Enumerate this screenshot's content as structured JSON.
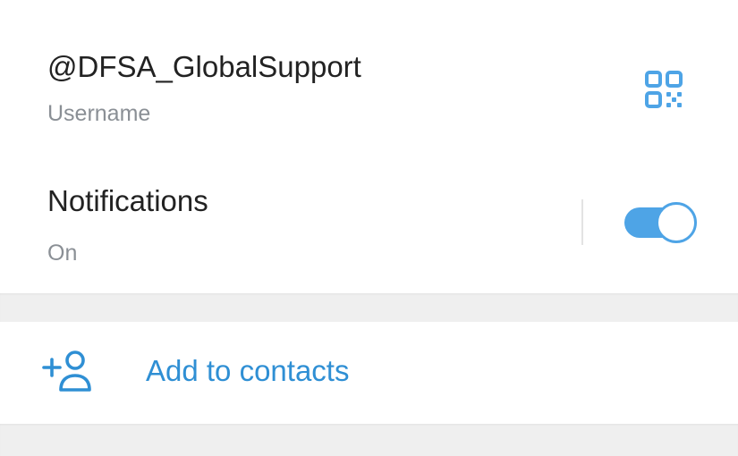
{
  "profile_info": {
    "username": {
      "value": "@DFSA_GlobalSupport",
      "label": "Username",
      "qr_icon": "qr-code-icon"
    },
    "notifications": {
      "title": "Notifications",
      "status": "On",
      "enabled": true
    }
  },
  "actions": {
    "add_to_contacts": {
      "label": "Add to contacts",
      "icon": "add-user-icon"
    }
  },
  "colors": {
    "accent": "#4ea4e6",
    "link": "#2f8fd4",
    "primary_text": "#222222",
    "secondary_text": "#8a8f95",
    "separator": "#efefef"
  }
}
